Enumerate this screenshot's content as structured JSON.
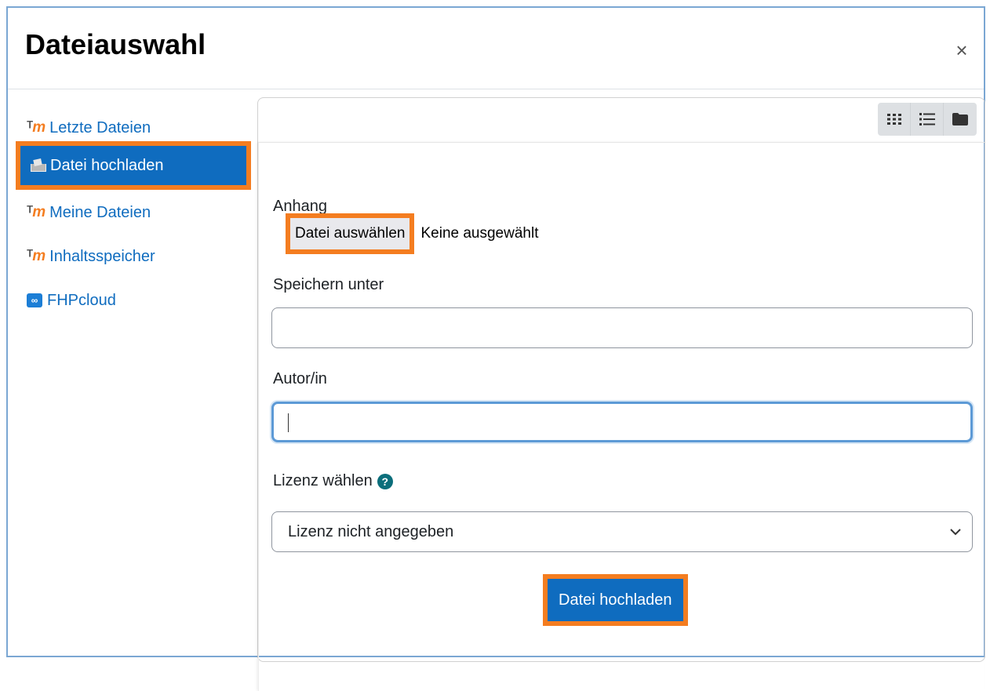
{
  "dialog": {
    "title": "Dateiauswahl",
    "close_symbol": "×"
  },
  "sidebar": {
    "items": [
      {
        "label": "Letzte Dateien",
        "icon": "moodle-icon"
      },
      {
        "label": "Datei hochladen",
        "icon": "upload-icon",
        "active": true
      },
      {
        "label": "Meine Dateien",
        "icon": "moodle-icon"
      },
      {
        "label": "Inhaltsspeicher",
        "icon": "moodle-icon"
      },
      {
        "label": "FHPcloud",
        "icon": "nextcloud-icon"
      }
    ]
  },
  "view_switch": [
    "grid-icon",
    "list-icon",
    "folder-icon"
  ],
  "form": {
    "attachment_label": "Anhang",
    "choose_button": "Datei auswählen",
    "no_file": "Keine ausgewählt",
    "save_as_label": "Speichern unter",
    "save_as_value": "",
    "author_label": "Autor/in",
    "author_value": "",
    "license_label": "Lizenz wählen",
    "license_selected": "Lizenz nicht angegeben",
    "upload_button": "Datei hochladen"
  },
  "colors": {
    "accent": "#0f6cbf",
    "highlight": "#f47d20",
    "focus": "#5d9ad6"
  }
}
